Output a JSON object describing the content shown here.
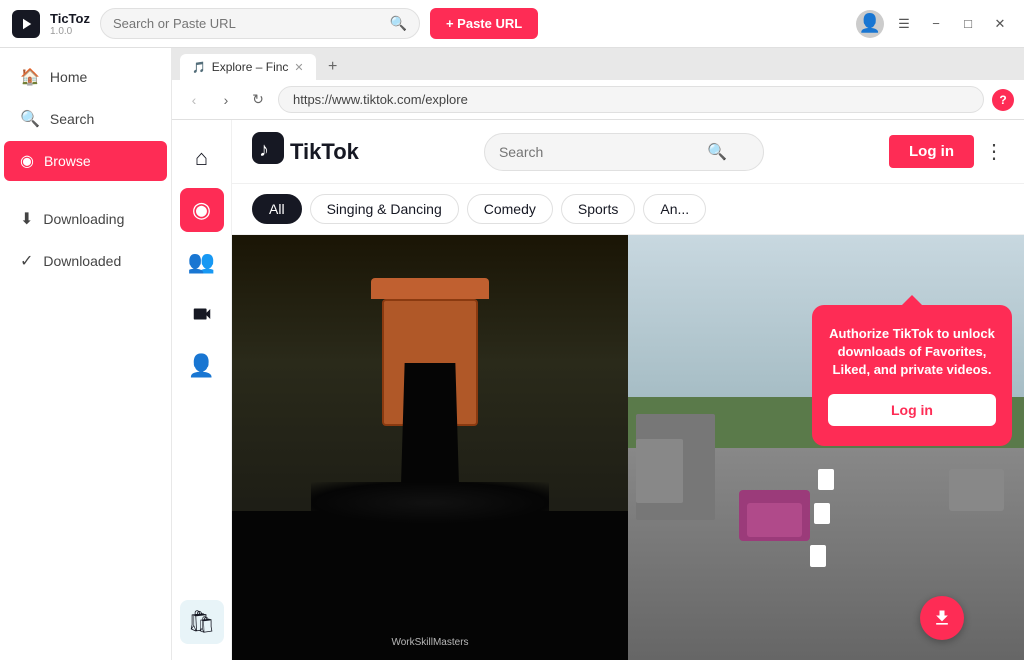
{
  "app": {
    "name": "TicToz",
    "version": "1.0.0",
    "logo_alt": "TicToz logo"
  },
  "titlebar": {
    "search_placeholder": "Search or Paste URL",
    "paste_url_label": "+ Paste URL",
    "avatar_alt": "User avatar"
  },
  "window_controls": {
    "menu_icon": "☰",
    "minimize_icon": "−",
    "maximize_icon": "□",
    "close_icon": "✕"
  },
  "sidebar": {
    "items": [
      {
        "id": "home",
        "label": "Home",
        "icon": "🏠"
      },
      {
        "id": "search",
        "label": "Search",
        "icon": "🔍"
      },
      {
        "id": "browse",
        "label": "Browse",
        "icon": "◉",
        "active": true
      }
    ],
    "bottom_items": [
      {
        "id": "downloading",
        "label": "Downloading",
        "icon": "⬇"
      },
      {
        "id": "downloaded",
        "label": "Downloaded",
        "icon": "✓"
      }
    ]
  },
  "browser": {
    "tab": {
      "favicon": "🎵",
      "title": "Explore – Finc",
      "url": "https://www.tiktok.com/explore"
    },
    "new_tab_label": "+"
  },
  "tiktok": {
    "logo_text": "TikTok",
    "search_placeholder": "Search",
    "login_button": "Log in",
    "categories": [
      {
        "id": "all",
        "label": "All",
        "active": true
      },
      {
        "id": "singing-dancing",
        "label": "Singing & Dancing"
      },
      {
        "id": "comedy",
        "label": "Comedy"
      },
      {
        "id": "sports",
        "label": "Sports"
      },
      {
        "id": "anime",
        "label": "An..."
      }
    ],
    "nav_icons": [
      {
        "id": "home",
        "icon": "⌂"
      },
      {
        "id": "explore",
        "icon": "◉"
      },
      {
        "id": "following",
        "icon": "👥"
      },
      {
        "id": "live",
        "icon": "▶"
      },
      {
        "id": "profile",
        "icon": "👤"
      },
      {
        "id": "shop",
        "icon": "🛍"
      }
    ],
    "popup": {
      "text": "Authorize TikTok to unlock downloads of Favorites, Liked, and private videos.",
      "login_button": "Log in"
    },
    "videos": [
      {
        "id": "video-1",
        "watermark": "WorkSkillMasters"
      },
      {
        "id": "video-2"
      }
    ]
  }
}
